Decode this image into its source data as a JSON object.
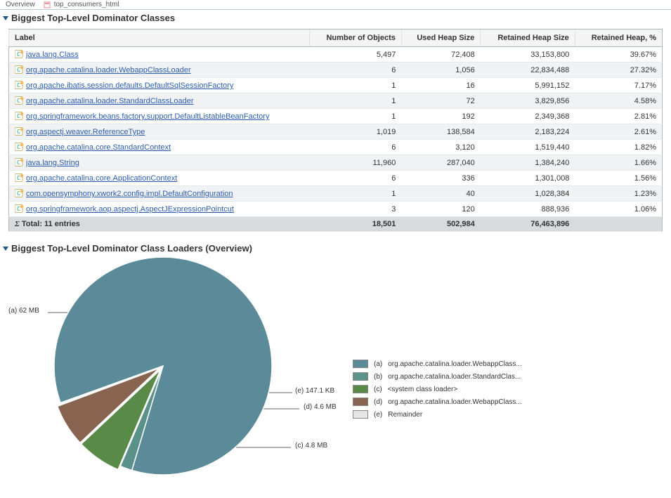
{
  "tabs": {
    "overview": "Overview",
    "top_consumers": "top_consumers_html"
  },
  "section1_title": "Biggest Top-Level Dominator Classes",
  "section2_title": "Biggest Top-Level Dominator Class Loaders (Overview)",
  "columns": {
    "label": "Label",
    "num": "Number of Objects",
    "used": "Used Heap Size",
    "retained": "Retained Heap Size",
    "pct": "Retained Heap, %"
  },
  "rows": [
    {
      "label": "java.lang.Class",
      "num": "5,497",
      "used": "72,408",
      "retained": "33,153,800",
      "pct": "39.67%"
    },
    {
      "label": "org.apache.catalina.loader.WebappClassLoader",
      "num": "6",
      "used": "1,056",
      "retained": "22,834,488",
      "pct": "27.32%"
    },
    {
      "label": "org.apache.ibatis.session.defaults.DefaultSqlSessionFactory",
      "num": "1",
      "used": "16",
      "retained": "5,991,152",
      "pct": "7.17%"
    },
    {
      "label": "org.apache.catalina.loader.StandardClassLoader",
      "num": "1",
      "used": "72",
      "retained": "3,829,856",
      "pct": "4.58%"
    },
    {
      "label": "org.springframework.beans.factory.support.DefaultListableBeanFactory",
      "num": "1",
      "used": "192",
      "retained": "2,349,368",
      "pct": "2.81%"
    },
    {
      "label": "org.aspectj.weaver.ReferenceType",
      "num": "1,019",
      "used": "138,584",
      "retained": "2,183,224",
      "pct": "2.61%"
    },
    {
      "label": "org.apache.catalina.core.StandardContext",
      "num": "6",
      "used": "3,120",
      "retained": "1,519,440",
      "pct": "1.82%"
    },
    {
      "label": "java.lang.String",
      "num": "11,960",
      "used": "287,040",
      "retained": "1,384,240",
      "pct": "1.66%"
    },
    {
      "label": "org.apache.catalina.core.ApplicationContext",
      "num": "6",
      "used": "336",
      "retained": "1,301,008",
      "pct": "1.56%"
    },
    {
      "label": "com.opensymphony.xwork2.config.impl.DefaultConfiguration",
      "num": "1",
      "used": "40",
      "retained": "1,028,384",
      "pct": "1.23%"
    },
    {
      "label": "org.springframework.aop.aspectj.AspectJExpressionPointcut",
      "num": "3",
      "used": "120",
      "retained": "888,936",
      "pct": "1.06%"
    }
  ],
  "total": {
    "label": "Total: 11 entries",
    "num": "18,501",
    "used": "502,984",
    "retained": "76,463,896",
    "pct": ""
  },
  "callouts": {
    "a": "(a) 62 MB",
    "c": "(c) 4.8 MB",
    "d": "(d) 4.6 MB",
    "e": "(e) 147.1 KB"
  },
  "legend": [
    {
      "letter": "(a)",
      "text": "org.apache.catalina.loader.WebappClass...",
      "color": "#5b8a99"
    },
    {
      "letter": "(b)",
      "text": "org.apache.catalina.loader.StandardClas...",
      "color": "#5a9189"
    },
    {
      "letter": "(c)",
      "text": "<system class loader>",
      "color": "#5a8a48"
    },
    {
      "letter": "(d)",
      "text": "org.apache.catalina.loader.WebappClass...",
      "color": "#886450"
    },
    {
      "letter": "(e)",
      "text": "Remainder",
      "color": "#e6e6e6"
    }
  ],
  "chart_data": {
    "type": "pie",
    "title": "Biggest Top-Level Dominator Class Loaders (Overview)",
    "series": [
      {
        "name": "(a) org.apache.catalina.loader.WebappClassLoader",
        "value_mb": 62.0,
        "color": "#5b8a99"
      },
      {
        "name": "(b) org.apache.catalina.loader.StandardClassLoader",
        "value_mb": 1.3,
        "color": "#5a9189"
      },
      {
        "name": "(c) <system class loader>",
        "value_mb": 4.8,
        "color": "#5a8a48"
      },
      {
        "name": "(d) org.apache.catalina.loader.WebappClassLoader",
        "value_mb": 4.6,
        "color": "#886450"
      },
      {
        "name": "(e) Remainder",
        "value_mb": 0.144,
        "color": "#e6e6e6"
      }
    ]
  }
}
